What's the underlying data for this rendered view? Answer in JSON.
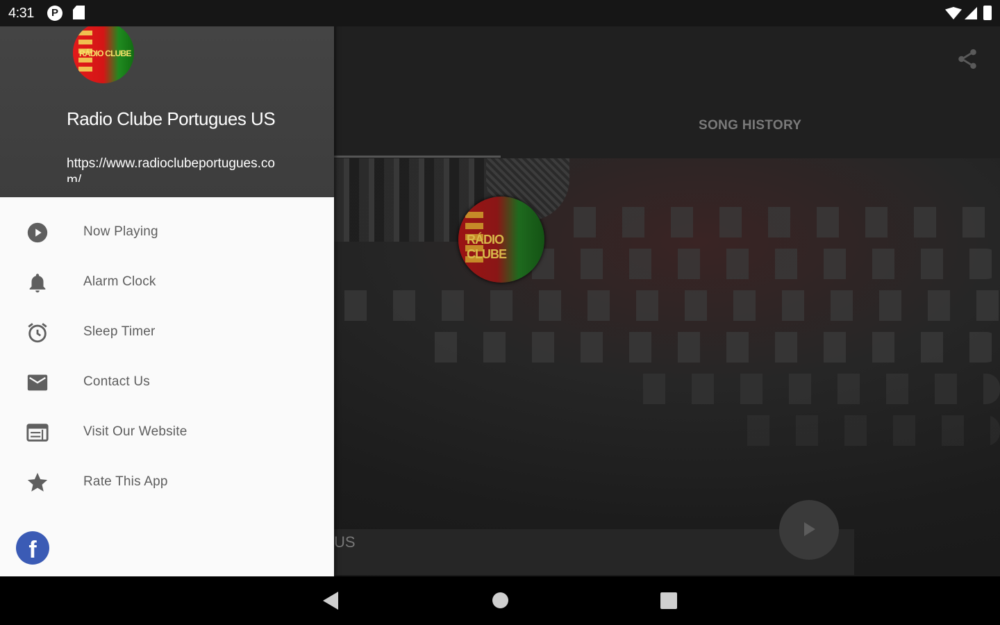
{
  "status_bar": {
    "time": "4:31",
    "left_icons": [
      "p-badge-icon",
      "sd-card-icon"
    ],
    "right_icons": [
      "wifi-icon",
      "signal-icon",
      "battery-icon"
    ],
    "p_badge": "P"
  },
  "drawer": {
    "station_name": "Radio Clube Portugues US",
    "station_url": "https://www.radioclubeportugues.com/",
    "logo_text": "RÁDIO CLUBE",
    "menu_items": [
      {
        "label": "Now Playing",
        "icon": "play-circle-icon"
      },
      {
        "label": "Alarm Clock",
        "icon": "bell-icon"
      },
      {
        "label": "Sleep Timer",
        "icon": "alarm-clock-icon"
      },
      {
        "label": "Contact Us",
        "icon": "mail-icon"
      },
      {
        "label": "Visit Our Website",
        "icon": "web-icon"
      },
      {
        "label": "Rate This App",
        "icon": "star-icon"
      }
    ],
    "facebook_glyph": "f",
    "icon_color": "#5f5f5f"
  },
  "main": {
    "tabs": [
      {
        "label": "SONG HISTORY"
      }
    ],
    "share_icon": "share-icon",
    "player_station_visible_text": "US",
    "center_logo_text": "RÁDIO CLUBE",
    "play_button_icon": "play-icon"
  },
  "colors": {
    "drawer_header": "#454545",
    "drawer_body": "#fafafa",
    "facebook_blue": "#3b5bb5",
    "logo_red": "#e21a1a",
    "logo_green": "#1f8a1f"
  },
  "nav_bar": {
    "buttons": [
      "back-icon",
      "home-icon",
      "recents-icon"
    ]
  }
}
